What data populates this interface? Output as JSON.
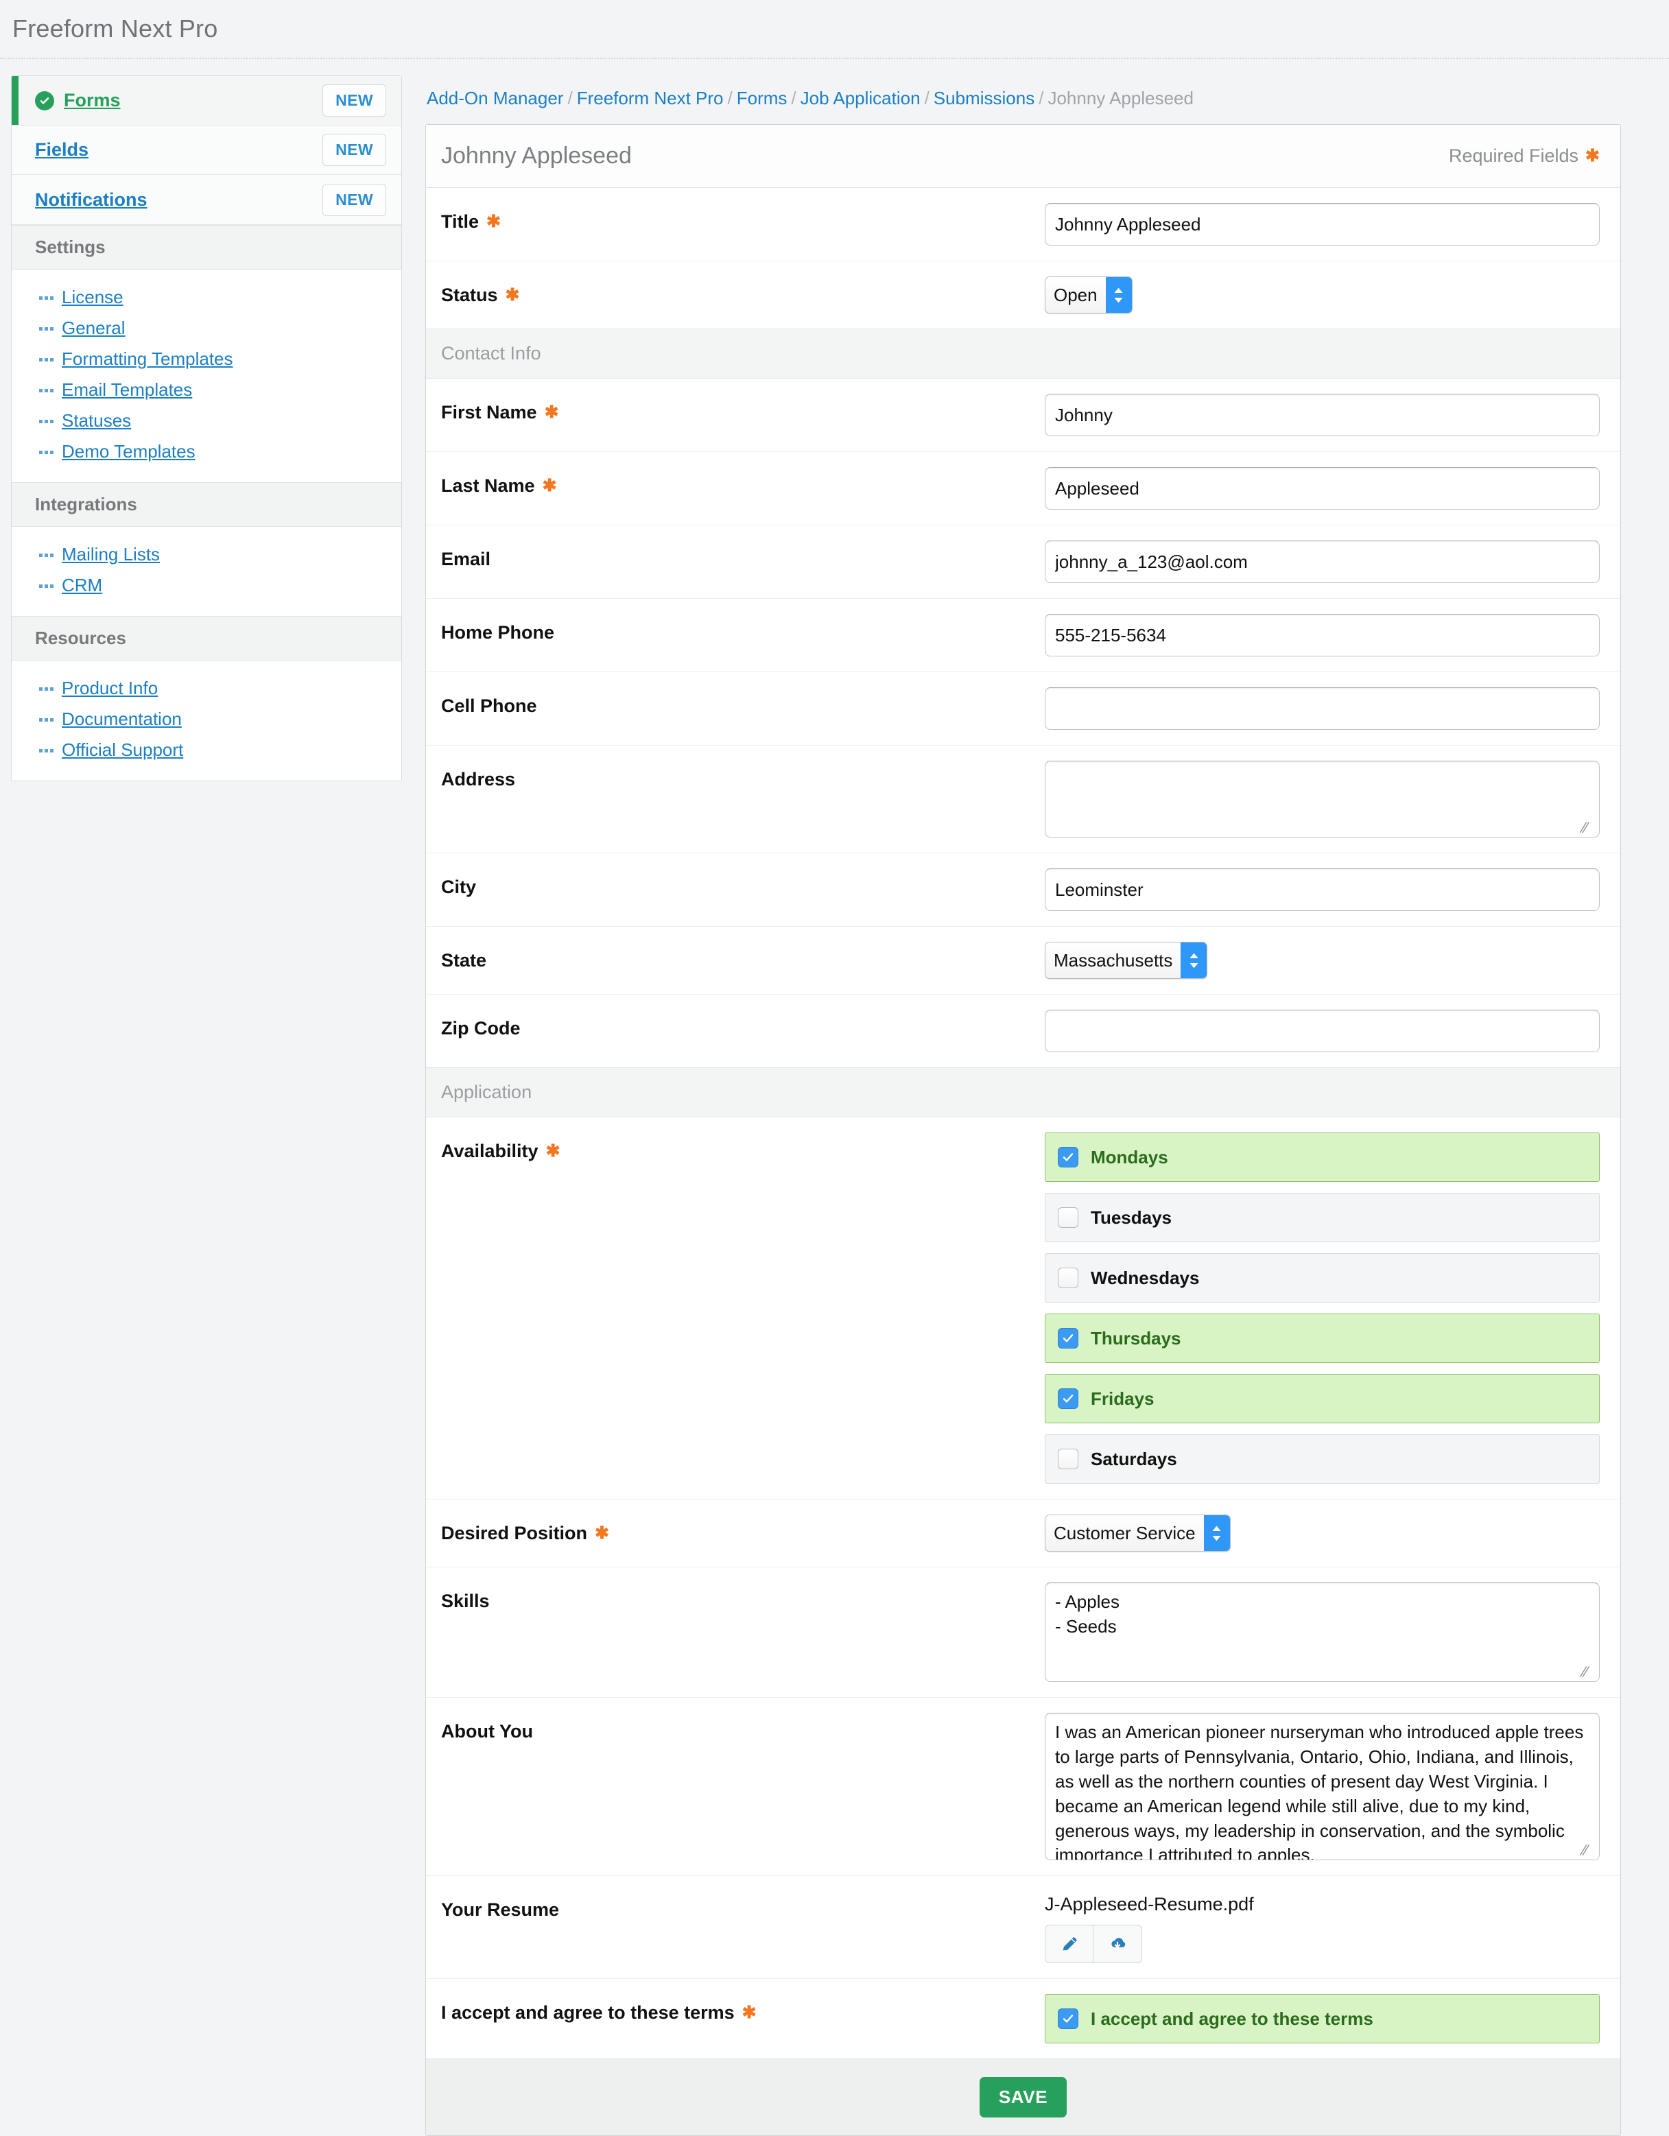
{
  "app": {
    "title": "Freeform Next Pro"
  },
  "sidebar": {
    "nav": [
      {
        "label": "Forms",
        "badge": "NEW",
        "active": true,
        "icon": "check-circle-icon"
      },
      {
        "label": "Fields",
        "badge": "NEW",
        "active": false
      },
      {
        "label": "Notifications",
        "badge": "NEW",
        "active": false
      }
    ],
    "groups": [
      {
        "title": "Settings",
        "links": [
          "License",
          "General",
          "Formatting Templates",
          "Email Templates",
          "Statuses",
          "Demo Templates"
        ]
      },
      {
        "title": "Integrations",
        "links": [
          "Mailing Lists",
          "CRM"
        ]
      },
      {
        "title": "Resources",
        "links": [
          "Product Info",
          "Documentation",
          "Official Support"
        ]
      }
    ]
  },
  "breadcrumb": {
    "items": [
      "Add-On Manager",
      "Freeform Next Pro",
      "Forms",
      "Job Application",
      "Submissions"
    ],
    "current": "Johnny Appleseed",
    "separator": "/"
  },
  "panel": {
    "title": "Johnny Appleseed",
    "required_note": "Required Fields",
    "required_mark": "✱",
    "save_label": "SAVE"
  },
  "form": {
    "title_label": "Title",
    "title_value": "Johnny Appleseed",
    "status_label": "Status",
    "status_value": "Open",
    "section_contact": "Contact Info",
    "first_name_label": "First Name",
    "first_name_value": "Johnny",
    "last_name_label": "Last Name",
    "last_name_value": "Appleseed",
    "email_label": "Email",
    "email_value": "johnny_a_123@aol.com",
    "home_phone_label": "Home Phone",
    "home_phone_value": "555-215-5634",
    "cell_phone_label": "Cell Phone",
    "cell_phone_value": "",
    "address_label": "Address",
    "address_value": "",
    "city_label": "City",
    "city_value": "Leominster",
    "state_label": "State",
    "state_value": "Massachusetts",
    "zip_label": "Zip Code",
    "zip_value": "",
    "section_application": "Application",
    "availability_label": "Availability",
    "availability": [
      {
        "label": "Mondays",
        "checked": true
      },
      {
        "label": "Tuesdays",
        "checked": false
      },
      {
        "label": "Wednesdays",
        "checked": false
      },
      {
        "label": "Thursdays",
        "checked": true
      },
      {
        "label": "Fridays",
        "checked": true
      },
      {
        "label": "Saturdays",
        "checked": false
      }
    ],
    "position_label": "Desired Position",
    "position_value": "Customer Service",
    "skills_label": "Skills",
    "skills_value": "- Apples\n- Seeds",
    "about_label": "About You",
    "about_value": "I was an American pioneer nurseryman who introduced apple trees to large parts of Pennsylvania, Ontario, Ohio, Indiana, and Illinois, as well as the northern counties of present day West Virginia. I became an American legend while still alive, due to my kind, generous ways, my leadership in conservation, and the symbolic importance I attributed to apples.",
    "resume_label": "Your Resume",
    "resume_file": "J-Appleseed-Resume.pdf",
    "resume_actions": [
      "pencil-icon",
      "cloud-download-icon"
    ],
    "terms_label": "I accept and agree to these terms",
    "terms_option": "I accept and agree to these terms",
    "terms_checked": true
  },
  "colors": {
    "accent_green": "#27a05c",
    "link_blue": "#1c7fc4",
    "required_orange": "#f4761f",
    "checked_bg": "#d9f4c4",
    "checkbox_blue": "#3b9bf2"
  }
}
